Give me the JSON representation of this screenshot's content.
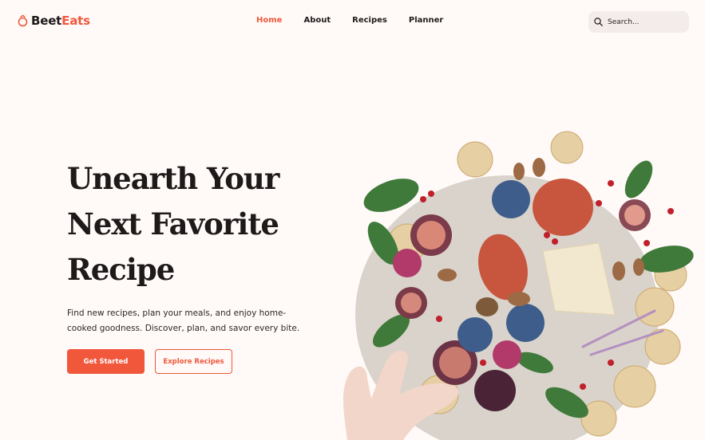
{
  "brand": {
    "name_part1": "Beet",
    "name_part2": "Eats",
    "icon": "beet-icon",
    "accent_color": "#f0573b"
  },
  "nav": {
    "items": [
      {
        "label": "Home",
        "active": true
      },
      {
        "label": "About",
        "active": false
      },
      {
        "label": "Recipes",
        "active": false
      },
      {
        "label": "Planner",
        "active": false
      }
    ]
  },
  "search": {
    "placeholder": "Search...",
    "value": "",
    "icon": "search-icon"
  },
  "hero": {
    "title_line1": "Unearth Your",
    "title_line2": "Next Favorite",
    "title_line3": "Recipe",
    "subtitle": "Find new recipes, plan your meals, and enjoy home-cooked goodness. Discover, plan, and savor every bite.",
    "primary_button": "Get Started",
    "secondary_button": "Explore Recipes"
  }
}
